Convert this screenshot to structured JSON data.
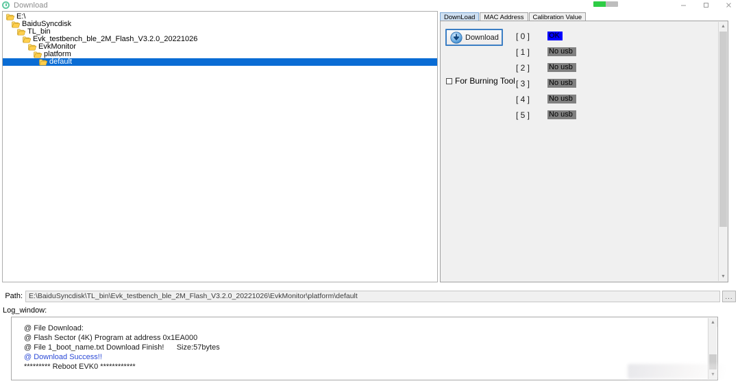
{
  "window": {
    "title": "Download",
    "icon": "download-circle-icon",
    "progress_percent": 50,
    "progress_color": "#2ecc45",
    "controls": {
      "minimize": "minimize-icon",
      "maximize": "maximize-icon",
      "close": "close-icon"
    }
  },
  "tree": {
    "items": [
      {
        "label": "E:\\",
        "depth": 0,
        "selected": false
      },
      {
        "label": "BaiduSyncdisk",
        "depth": 1,
        "selected": false
      },
      {
        "label": "TL_bin",
        "depth": 2,
        "selected": false
      },
      {
        "label": "Evk_testbench_ble_2M_Flash_V3.2.0_20221026",
        "depth": 3,
        "selected": false
      },
      {
        "label": "EvkMonitor",
        "depth": 4,
        "selected": false
      },
      {
        "label": "platform",
        "depth": 5,
        "selected": false
      },
      {
        "label": "default",
        "depth": 6,
        "selected": true
      }
    ]
  },
  "tabs": [
    {
      "label": "DownLoad",
      "active": true
    },
    {
      "label": "MAC Address",
      "active": false
    },
    {
      "label": "Calibration Value",
      "active": false
    }
  ],
  "download_panel": {
    "button_label": "Download",
    "button_icon": "download-arrow-icon",
    "burning_tool_label": "For Burning Tool",
    "burning_tool_checked": false,
    "slots": [
      {
        "index": "[ 0 ]",
        "status": "OK",
        "state": "ok"
      },
      {
        "index": "[ 1 ]",
        "status": "No usb",
        "state": "nousb"
      },
      {
        "index": "[ 2 ]",
        "status": "No usb",
        "state": "nousb"
      },
      {
        "index": "[ 3 ]",
        "status": "No usb",
        "state": "nousb"
      },
      {
        "index": "[ 4 ]",
        "status": "No usb",
        "state": "nousb"
      },
      {
        "index": "[ 5 ]",
        "status": "No usb",
        "state": "nousb"
      }
    ]
  },
  "path": {
    "label": "Path:",
    "value": "E:\\BaiduSyncdisk\\TL_bin\\Evk_testbench_ble_2M_Flash_V3.2.0_20221026\\EvkMonitor\\platform\\default",
    "browse_label": "..."
  },
  "log": {
    "label": "Log_window:",
    "lines": [
      {
        "text": "@ File Download:",
        "style": "normal"
      },
      {
        "text": "@ Flash Sector (4K) Program at address 0x1EA000",
        "style": "normal"
      },
      {
        "text": "@ File 1_boot_name.txt Download Finish!      Size:57bytes",
        "style": "normal"
      },
      {
        "text": "@ Download Success!!",
        "style": "blue"
      },
      {
        "text": "********* Reboot EVK0 ************",
        "style": "normal"
      }
    ]
  }
}
